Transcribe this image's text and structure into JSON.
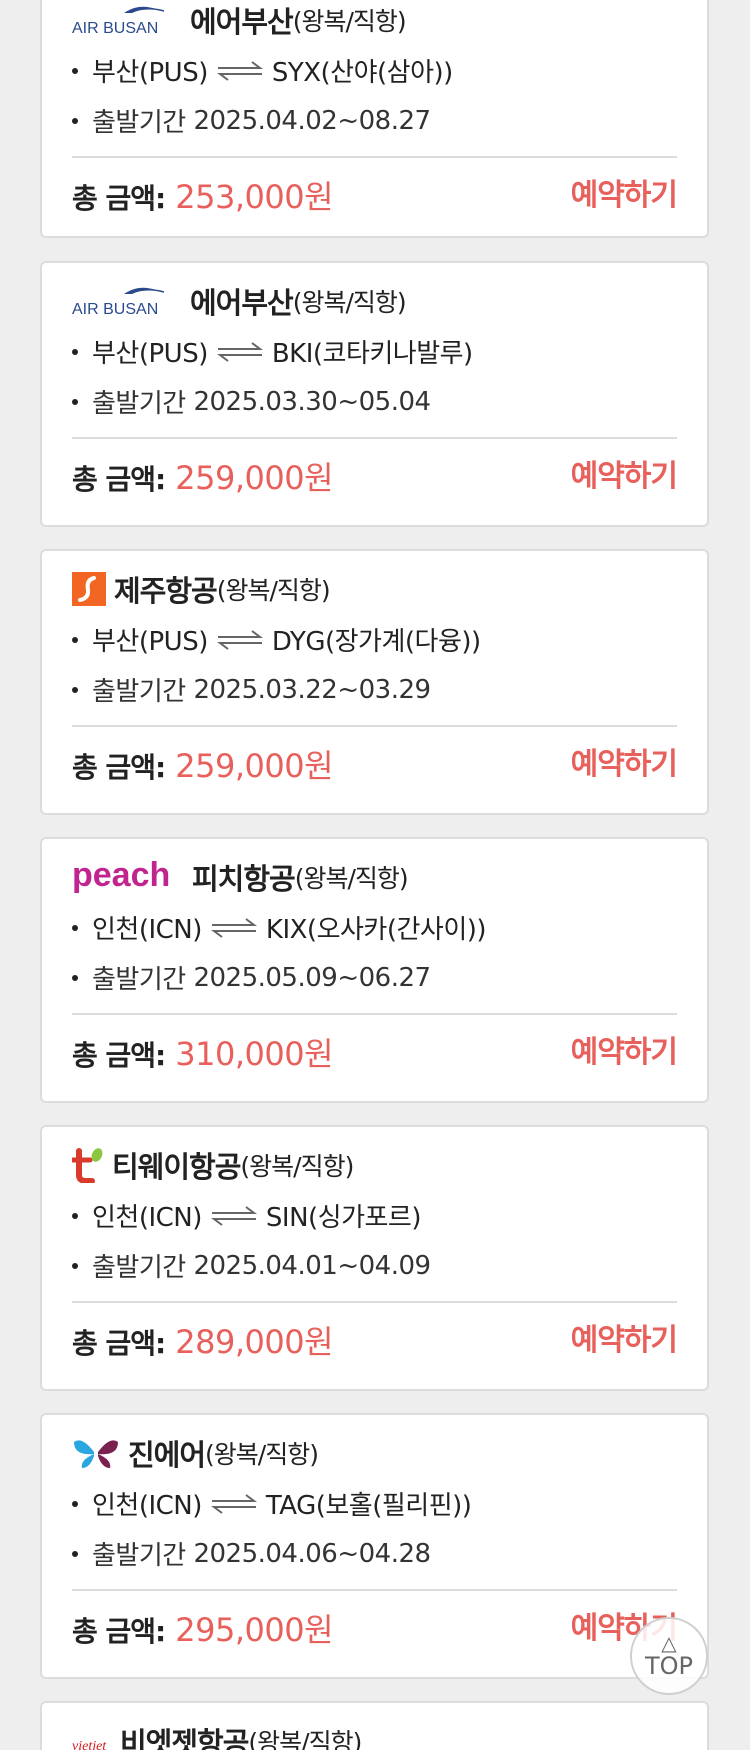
{
  "deals": [
    {
      "logo": "air-busan-logo",
      "logo_text": "AIR BUSAN",
      "airline": "에어부산",
      "trip_type": "(왕복/직항)",
      "route_from": "부산(PUS)",
      "route_to": "SYX(산야(삼아))",
      "period_label": "출발기간",
      "period": "2025.04.02~08.27",
      "total_label": "총 금액:",
      "price": "253,000원",
      "book_label": "예약하기"
    },
    {
      "logo": "air-busan-logo",
      "logo_text": "AIR BUSAN",
      "airline": "에어부산",
      "trip_type": "(왕복/직항)",
      "route_from": "부산(PUS)",
      "route_to": "BKI(코타키나발루)",
      "period_label": "출발기간",
      "period": "2025.03.30~05.04",
      "total_label": "총 금액:",
      "price": "259,000원",
      "book_label": "예약하기"
    },
    {
      "logo": "jeju-air-logo",
      "logo_text": "",
      "airline": "제주항공",
      "trip_type": "(왕복/직항)",
      "route_from": "부산(PUS)",
      "route_to": "DYG(장가계(다융))",
      "period_label": "출발기간",
      "period": "2025.03.22~03.29",
      "total_label": "총 금액:",
      "price": "259,000원",
      "book_label": "예약하기"
    },
    {
      "logo": "peach-logo",
      "logo_text": "peach",
      "airline": "피치항공",
      "trip_type": "(왕복/직항)",
      "route_from": "인천(ICN)",
      "route_to": "KIX(오사카(간사이))",
      "period_label": "출발기간",
      "period": "2025.05.09~06.27",
      "total_label": "총 금액:",
      "price": "310,000원",
      "book_label": "예약하기"
    },
    {
      "logo": "tway-logo",
      "logo_text": "",
      "airline": "티웨이항공",
      "trip_type": "(왕복/직항)",
      "route_from": "인천(ICN)",
      "route_to": "SIN(싱가포르)",
      "period_label": "출발기간",
      "period": "2025.04.01~04.09",
      "total_label": "총 금액:",
      "price": "289,000원",
      "book_label": "예약하기"
    },
    {
      "logo": "jin-air-logo",
      "logo_text": "",
      "airline": "진에어",
      "trip_type": "(왕복/직항)",
      "route_from": "인천(ICN)",
      "route_to": "TAG(보홀(필리핀))",
      "period_label": "출발기간",
      "period": "2025.04.06~04.28",
      "total_label": "총 금액:",
      "price": "295,000원",
      "book_label": "예약하기"
    },
    {
      "logo": "vietjet-logo",
      "logo_text": "vietjet",
      "airline": "비엣젯항공",
      "trip_type": "(왕복/직항)"
    }
  ],
  "top_button": {
    "arrow": "△",
    "label": "TOP"
  },
  "colors": {
    "accent": "#e8605c",
    "background": "#eeeeee",
    "card_border": "#dcdcdc"
  }
}
